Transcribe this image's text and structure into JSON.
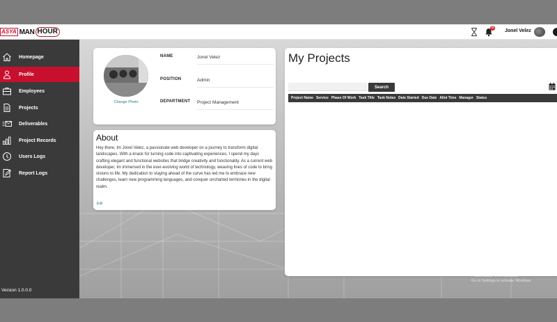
{
  "header": {
    "logo": {
      "part1": "ASYA",
      "part2": "MAN",
      "part3": "HOUR"
    },
    "notification_count": "0",
    "username": "Jonel Velez",
    "icons": [
      "hourglass-icon",
      "bell-icon",
      "user-avatar",
      "chevron-down-icon"
    ]
  },
  "sidebar": {
    "items": [
      {
        "label": "Homepage",
        "icon": "home-icon"
      },
      {
        "label": "Profile",
        "icon": "profile-icon",
        "active": true
      },
      {
        "label": "Employees",
        "icon": "briefcase-icon"
      },
      {
        "label": "Projects",
        "icon": "document-icon"
      },
      {
        "label": "Deliverables",
        "icon": "mail-list-icon"
      },
      {
        "label": "Project Records",
        "icon": "bar-chart-icon"
      },
      {
        "label": "Users Logs",
        "icon": "clock-icon"
      },
      {
        "label": "Report Logs",
        "icon": "edit-report-icon"
      }
    ],
    "version": "Version 1.0.0.0"
  },
  "profile": {
    "change_photo": "Change Photo",
    "fields": [
      {
        "label": "NAME",
        "value": "Jonel Velez"
      },
      {
        "label": "POSITION",
        "value": "Admin"
      },
      {
        "label": "DEPARTMENT",
        "value": "Project Management"
      }
    ]
  },
  "about": {
    "title": "About",
    "text": "Hey there, Im Jonel Velez, a passionate web developer on a journey to transform digital landscapes. With a knack for turning code into captivating experiences, I spend my days crafting elegant and functional websites that bridge creativity and functionality. As a current web developer, Im immersed in the ever-evolving world of technology, weaving lines of code to bring visions to life. My dedication to staying ahead of the curve has led me to embrace new challenges, learn new programming languages, and conquer uncharted territories in the digital realm.",
    "edit": "Edit"
  },
  "projects": {
    "title": "My Projects",
    "search_label": "Search",
    "search_value": "",
    "columns": [
      "Project Name",
      "Service",
      "Phase Of Work",
      "Task Title",
      "Task Notes",
      "Date Started",
      "Due Date",
      "Allot Time",
      "Manager",
      "Status"
    ],
    "rows": []
  },
  "watermark": {
    "title": "Activate Windows",
    "subtitle": "Go to Settings to activate Windows."
  },
  "colors": {
    "accent": "#c8102e",
    "sidebar": "#3a3a3a",
    "table_header": "#3a3a3a",
    "link": "#2a7a8c"
  }
}
